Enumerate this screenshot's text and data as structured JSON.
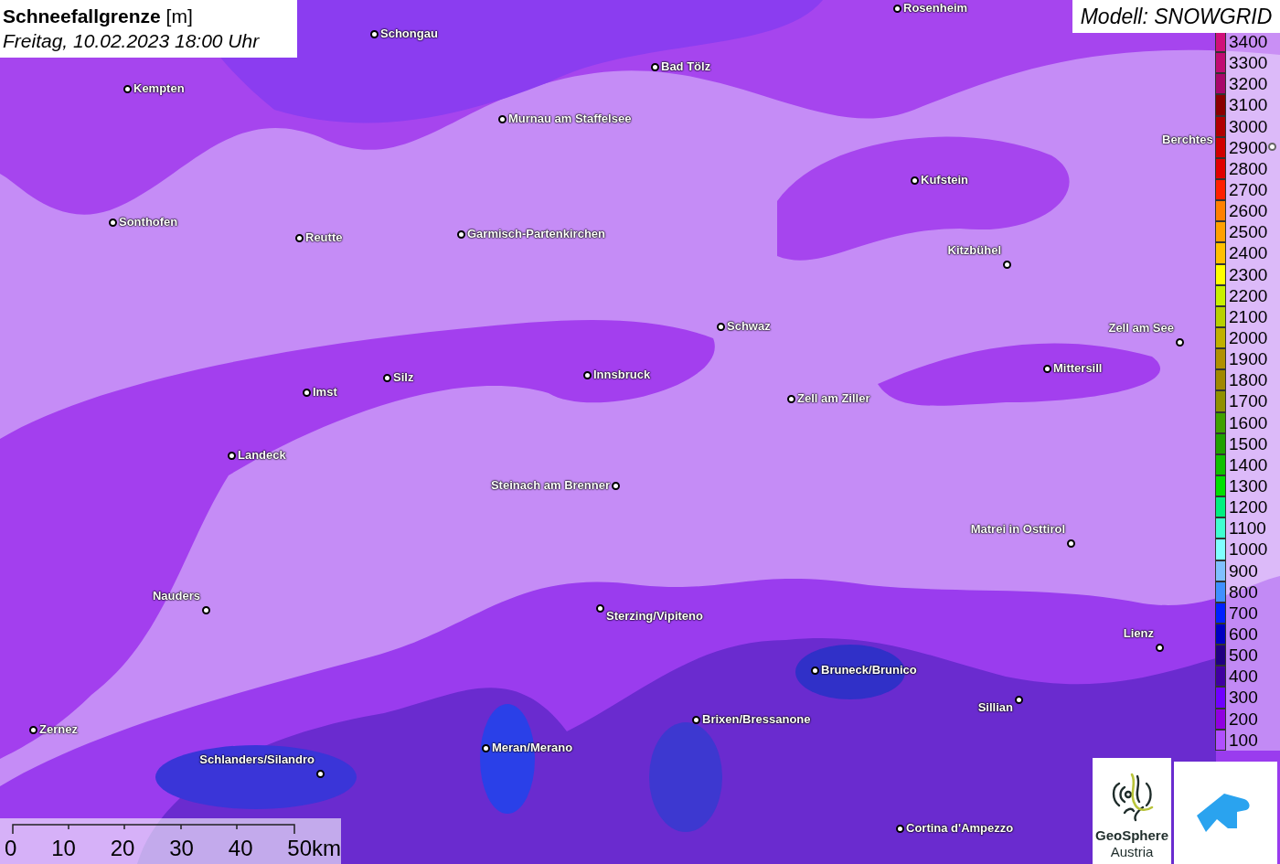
{
  "title": {
    "heading": "**Schneefallgrenze** [m]",
    "subtitle": "Freitag, 10.02.2023 18:00 Uhr"
  },
  "model": "Modell: SNOWGRID",
  "cities": [
    {
      "name": "Rosenheim"
    },
    {
      "name": "Schongau"
    },
    {
      "name": "Bad Tölz"
    },
    {
      "name": "Kempten"
    },
    {
      "name": "Murnau am Staffelsee"
    },
    {
      "name": "Berchtes"
    },
    {
      "name": "Kufstein"
    },
    {
      "name": "Sonthofen"
    },
    {
      "name": "Reutte"
    },
    {
      "name": "Garmisch-Partenkirchen"
    },
    {
      "name": "Kitzbühel"
    },
    {
      "name": "Schwaz"
    },
    {
      "name": "Zell am See"
    },
    {
      "name": "Mittersill"
    },
    {
      "name": "Innsbruck"
    },
    {
      "name": "Silz"
    },
    {
      "name": "Imst"
    },
    {
      "name": "Zell am Ziller"
    },
    {
      "name": "Landeck"
    },
    {
      "name": "Steinach am Brenner"
    },
    {
      "name": "Matrei in Osttirol"
    },
    {
      "name": "Nauders"
    },
    {
      "name": "Sterzing/Vipiteno"
    },
    {
      "name": "Lienz"
    },
    {
      "name": "Bruneck/Brunico"
    },
    {
      "name": "Sillian"
    },
    {
      "name": "Brixen/Bressanone"
    },
    {
      "name": "Zernez"
    },
    {
      "name": "Meran/Merano"
    },
    {
      "name": "Schlanders/Silandro"
    },
    {
      "name": "Cortina d'Ampezzo"
    }
  ],
  "legend": [
    {
      "label": "3400",
      "color": "#d0107a"
    },
    {
      "label": "3300",
      "color": "#c00c72"
    },
    {
      "label": "3200",
      "color": "#a8066a"
    },
    {
      "label": "3100",
      "color": "#8a0000"
    },
    {
      "label": "3000",
      "color": "#b00000"
    },
    {
      "label": "2900",
      "color": "#d00000"
    },
    {
      "label": "2800",
      "color": "#e00000"
    },
    {
      "label": "2700",
      "color": "#ff2000"
    },
    {
      "label": "2600",
      "color": "#ff8000"
    },
    {
      "label": "2500",
      "color": "#ffa000"
    },
    {
      "label": "2400",
      "color": "#ffc000"
    },
    {
      "label": "2300",
      "color": "#ffff00"
    },
    {
      "label": "2200",
      "color": "#c8f000"
    },
    {
      "label": "2100",
      "color": "#b8d000"
    },
    {
      "label": "2000",
      "color": "#c0b000"
    },
    {
      "label": "1900",
      "color": "#b09000"
    },
    {
      "label": "1800",
      "color": "#a08800"
    },
    {
      "label": "1700",
      "color": "#909000"
    },
    {
      "label": "1600",
      "color": "#40a000"
    },
    {
      "label": "1500",
      "color": "#20a000"
    },
    {
      "label": "1400",
      "color": "#10c000"
    },
    {
      "label": "1300",
      "color": "#00e000"
    },
    {
      "label": "1200",
      "color": "#00f080"
    },
    {
      "label": "1100",
      "color": "#40ffd0"
    },
    {
      "label": "1000",
      "color": "#80ffff"
    },
    {
      "label": "900",
      "color": "#80c0ff"
    },
    {
      "label": "800",
      "color": "#4090ff"
    },
    {
      "label": "700",
      "color": "#0020ff"
    },
    {
      "label": "600",
      "color": "#0000c0"
    },
    {
      "label": "500",
      "color": "#200080"
    },
    {
      "label": "400",
      "color": "#4000a0"
    },
    {
      "label": "300",
      "color": "#7000ff"
    },
    {
      "label": "200",
      "color": "#9000e0"
    },
    {
      "label": "100",
      "color": "#b050ff"
    }
  ],
  "scale": [
    "0",
    "10",
    "20",
    "30",
    "40",
    "50km"
  ],
  "logo": {
    "line1": "GeoSphere",
    "line2": "Austria"
  }
}
